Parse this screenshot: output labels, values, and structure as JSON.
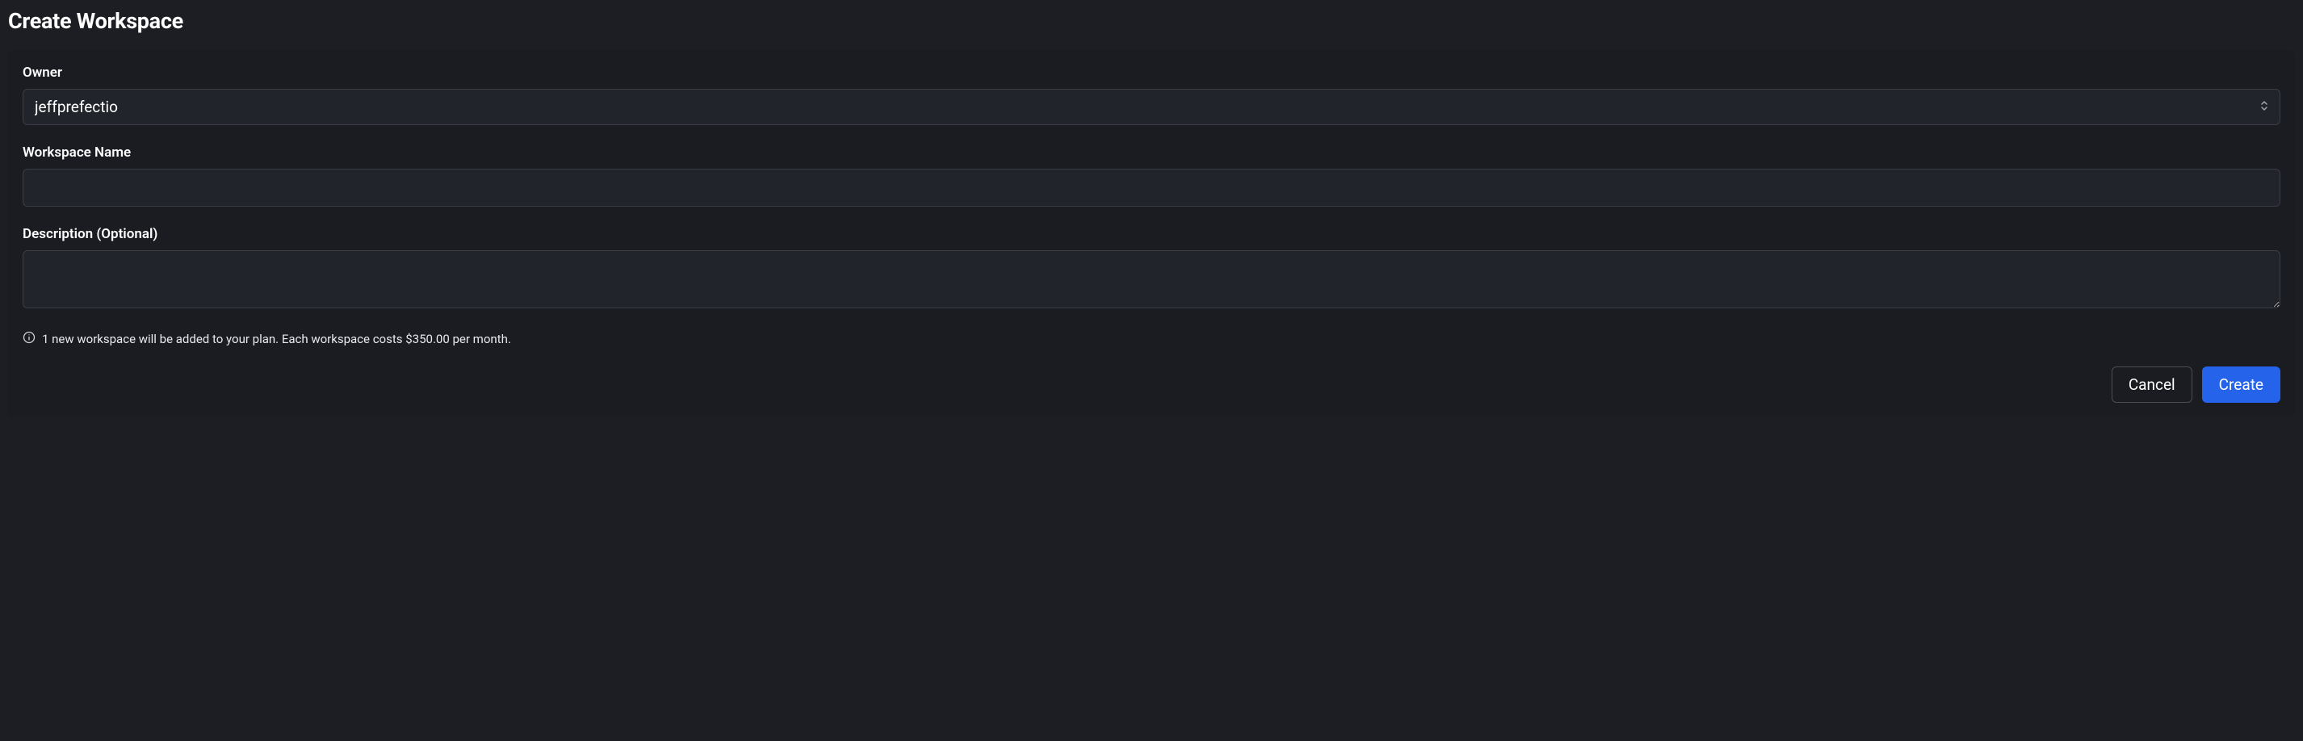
{
  "title": "Create Workspace",
  "form": {
    "owner": {
      "label": "Owner",
      "value": "jeffprefectio"
    },
    "workspace_name": {
      "label": "Workspace Name",
      "value": ""
    },
    "description": {
      "label": "Description (Optional)",
      "value": ""
    },
    "info_text": "1 new workspace will be added to your plan. Each workspace costs $350.00 per month."
  },
  "buttons": {
    "cancel": "Cancel",
    "create": "Create"
  }
}
